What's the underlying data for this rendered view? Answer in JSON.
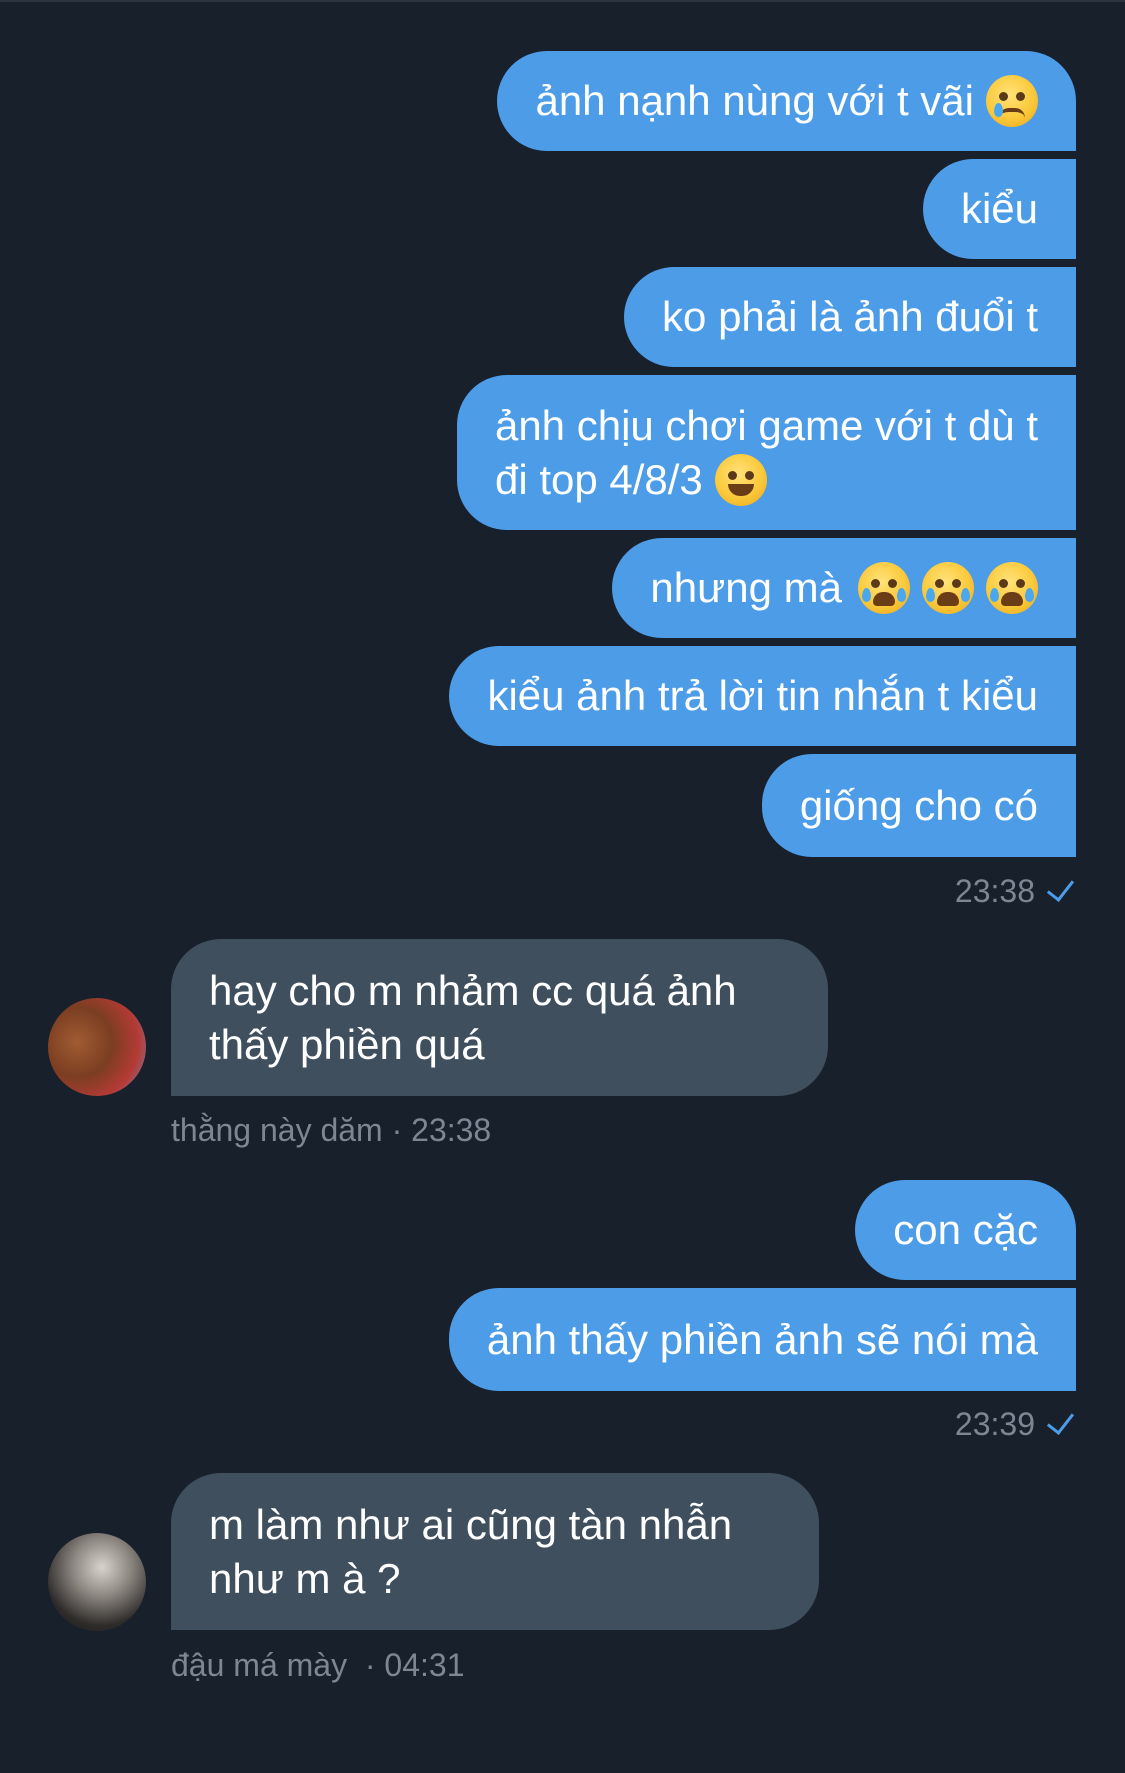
{
  "chat": {
    "messages_out_1": [
      {
        "text": "ảnh nạnh nùng với t vãi",
        "emoji": [
          "crying-face"
        ]
      },
      {
        "text": "kiểu"
      },
      {
        "text": "ko phải là ảnh đuổi t"
      },
      {
        "line1": "ảnh chịu chơi game với t dù t",
        "line2": "đi top 4/8/3",
        "emoji": [
          "grinning-face"
        ]
      },
      {
        "text": "nhưng mà",
        "emoji": [
          "loudly-crying-face",
          "loudly-crying-face",
          "loudly-crying-face"
        ]
      },
      {
        "text": "kiểu ảnh trả lời tin nhắn t kiểu"
      },
      {
        "text": "giống cho có"
      }
    ],
    "time_1": "23:38",
    "incoming_1": {
      "line1": "hay cho m nhảm cc quá ảnh",
      "line2": "thấy phiền quá",
      "sender": "thằng này dăm",
      "separator": "·",
      "time": "23:38"
    },
    "messages_out_2": [
      {
        "text": "con cặc"
      },
      {
        "text": "ảnh thấy phiền ảnh sẽ nói mà"
      }
    ],
    "time_2": "23:39",
    "incoming_2": {
      "line1": "m làm như ai cũng tàn nhẫn",
      "line2": "như m à ?",
      "sender": "đậu má mày",
      "separator": "·",
      "time": "04:31"
    }
  },
  "colors": {
    "background": "#18202b",
    "outgoing_bubble": "#4d9ce8",
    "incoming_bubble": "#3f4f5e",
    "meta_text": "#7d8793"
  }
}
